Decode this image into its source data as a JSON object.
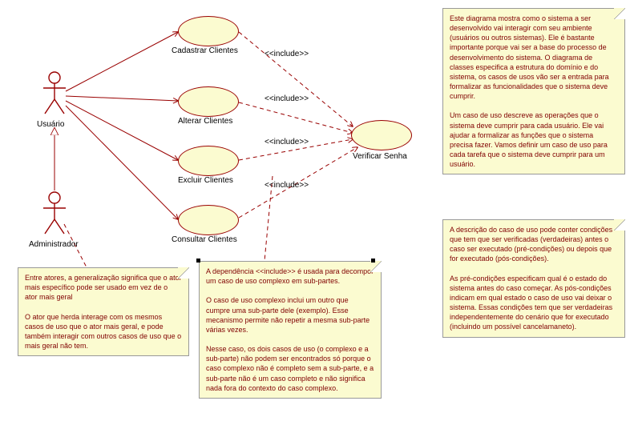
{
  "actors": {
    "user": "Usuário",
    "admin": "Administrador"
  },
  "usecases": {
    "cadastrar": "Cadastrar Clientes",
    "alterar": "Alterar Clientes",
    "excluir": "Excluir Clientes",
    "consultar": "Consultar Clientes",
    "verificar": "Verificar Senha"
  },
  "include_label": "<<include>>",
  "notes": {
    "topright": "Este diagrama mostra como o sistema a ser desenvolvido vai interagir com seu ambiente (usuários ou outros sistemas). Ele é bastante importante porque vai ser a base do processo de desenvolvimento do sistema. O diagrama de classes especifica a estrutura do domínio e do sistema, os casos de usos vão ser a entrada para formalizar as funcionalidades que o sistema deve cumprir.\n\nUm caso de uso descreve as operações que o sistema deve cumprir para cada usuário. Ele vai ajudar a formalizar as funções que o sistema precisa fazer. Vamos definir um caso de uso para cada tarefa que o sistema deve cumprir para um usuário.",
    "botright": "A descrição do caso de uso pode conter condições que tem que ser verificadas (verdadeiras) antes o caso ser executado (pré-condições) ou depois que for executado (pós-condições).\n\nAs pré-condições especificam qual é o estado do sistema antes do caso começar. As pós-condições indicam em qual estado o caso de uso vai deixar o sistema. Essas condições tem que ser verdadeiras independentemente do cenário que for executado (incluindo um possível cancelamaneto).",
    "left": "Entre atores, a generalização significa que o ator mais específico pode ser usado em vez de o ator mais geral\n\nO ator que herda interage com os mesmos casos de uso que o ator mais geral, e pode também interagir com outros casos de uso que o mais geral não tem.",
    "center": "A dependência <<include>> é usada para decompor um caso de uso complexo em sub-partes.\n\nO caso de uso complexo inclui um outro que cumpre uma sub-parte dele (exemplo). Esse mecanismo permite não repetir a mesma sub-parte várias vezes.\n\n Nesse caso, os dois casos de uso (o complexo e a sub-parte) não podem ser encontrados só porque o caso complexo não é completo sem a sub-parte, e a sub-parte não é um caso completo e não significa nada fora do contexto do caso complexo."
  }
}
